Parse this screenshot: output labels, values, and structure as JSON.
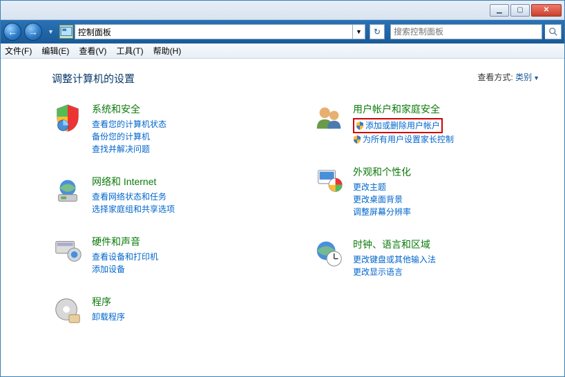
{
  "titlebar": {},
  "nav": {
    "address": "控制面板",
    "search_placeholder": "搜索控制面板"
  },
  "menu": {
    "file": "文件(F)",
    "edit": "编辑(E)",
    "view": "查看(V)",
    "tools": "工具(T)",
    "help": "帮助(H)"
  },
  "heading": "调整计算机的设置",
  "viewmode_label": "查看方式:",
  "viewmode_value": "类别",
  "categories": {
    "system": {
      "title": "系统和安全",
      "links": [
        "查看您的计算机状态",
        "备份您的计算机",
        "查找并解决问题"
      ]
    },
    "network": {
      "title": "网络和 Internet",
      "links": [
        "查看网络状态和任务",
        "选择家庭组和共享选项"
      ]
    },
    "hardware": {
      "title": "硬件和声音",
      "links": [
        "查看设备和打印机",
        "添加设备"
      ]
    },
    "programs": {
      "title": "程序",
      "links": [
        "卸载程序"
      ]
    },
    "users": {
      "title": "用户帐户和家庭安全",
      "links": [
        "添加或删除用户帐户",
        "为所有用户设置家长控制"
      ]
    },
    "appearance": {
      "title": "外观和个性化",
      "links": [
        "更改主题",
        "更改桌面背景",
        "调整屏幕分辨率"
      ]
    },
    "clock": {
      "title": "时钟、语言和区域",
      "links": [
        "更改键盘或其他输入法",
        "更改显示语言"
      ]
    }
  }
}
